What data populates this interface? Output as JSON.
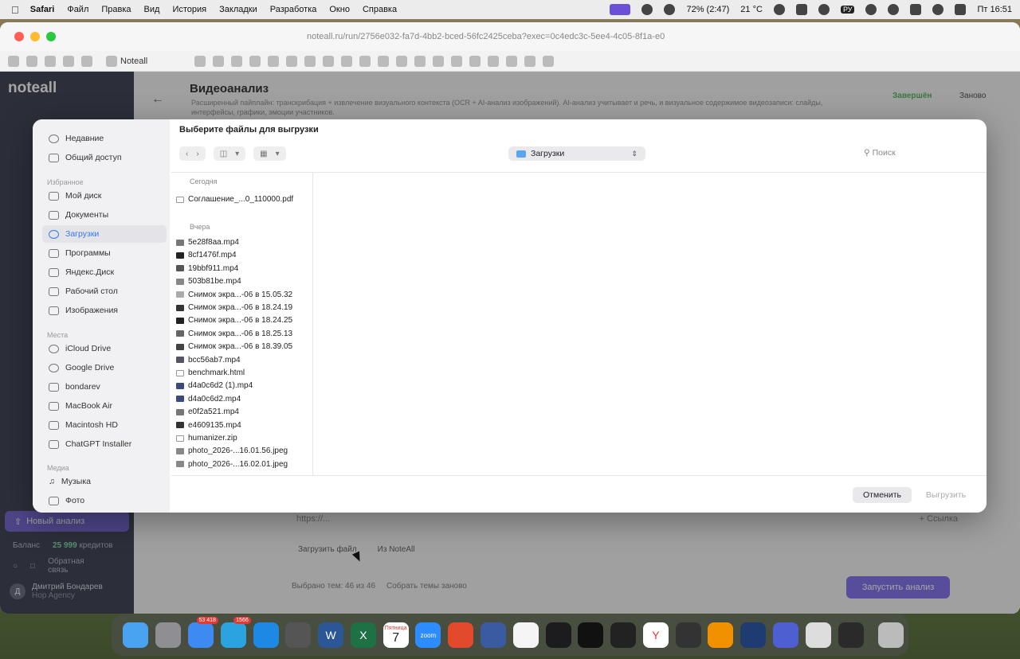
{
  "menubar": {
    "app": "Safari",
    "items": [
      "Файл",
      "Правка",
      "Вид",
      "История",
      "Закладки",
      "Разработка",
      "Окно",
      "Справка"
    ],
    "battery": "72% (2:47)",
    "weather": "21 °C",
    "lang": "РУ",
    "clock": "Пт 16:51"
  },
  "browser": {
    "url": "noteall.ru/run/2756e032-fa7d-4bb2-bced-56fc2425ceba?exec=0c4edc3c-5ee4-4c05-8f1a-e0",
    "bookmark_label": "Noteall"
  },
  "app": {
    "logo": "noteall",
    "page_title": "Видеоанализ",
    "page_description": "Расширенный пайплайн: транскрибация + извлечение визуального контекста (OCR + AI-анализ изображений). AI-анализ учитывает и речь, и визуальное содержимое видеозаписи: слайды, интерфейсы, графики, эмоции участников.",
    "status": "Завершён",
    "restart": "Заново",
    "new_analysis": "Новый анализ",
    "balance_label": "Баланс",
    "balance_value": "25 999",
    "balance_unit": "кредитов",
    "feedback": "Обратная связь",
    "user_name": "Дмитрий Бондарев",
    "user_sub": "Hop Agency",
    "user_initial": "Д",
    "url_placeholder": "https://...",
    "add_link": "+ Ссылка",
    "upload_file": "Загрузить файл",
    "from_noteall": "Из NoteAll",
    "selected_topics": "Выбрано тем: 46 из 46",
    "collect_topics": "Собрать темы заново",
    "run_analysis": "Запустить анализ"
  },
  "dialog": {
    "title": "Выберите файлы для выгрузки",
    "location": "Загрузки",
    "search": "Поиск",
    "cancel": "Отменить",
    "upload": "Выгрузить",
    "sidebar": {
      "recent": "Недавние",
      "shared": "Общий доступ",
      "fav_header": "Избранное",
      "my_disk": "Мой диск",
      "documents": "Документы",
      "downloads": "Загрузки",
      "programs": "Программы",
      "yandex": "Яндекс.Диск",
      "desktop": "Рабочий стол",
      "images": "Изображения",
      "places_header": "Места",
      "icloud": "iCloud Drive",
      "gdrive": "Google Drive",
      "bondarev": "bondarev",
      "macbook": "MacBook Air",
      "macintosh": "Macintosh HD",
      "chatgpt": "ChatGPT Installer",
      "media_header": "Медиа",
      "music": "Музыка",
      "photo": "Фото"
    },
    "today_label": "Сегодня",
    "today_files": [
      "Соглашение_...0_110000.pdf"
    ],
    "yesterday_label": "Вчера",
    "yesterday_files": [
      "5e28f8aa.mp4",
      "8cf1476f.mp4",
      "19bbf911.mp4",
      "503b81be.mp4",
      "Снимок экра...-06 в 15.05.32",
      "Снимок экра...-06 в 18.24.19",
      "Снимок экра...-06 в 18.24.25",
      "Снимок экра...-06 в 18.25.13",
      "Снимок экра...-06 в 18.39.05",
      "bcc56ab7.mp4",
      "benchmark.html",
      "d4a0c6d2 (1).mp4",
      "d4a0c6d2.mp4",
      "e0f2a521.mp4",
      "e4609135.mp4",
      "humanizer.zip",
      "photo_2026-...16.01.56.jpeg",
      "photo_2026-...16.02.01.jpeg"
    ]
  },
  "dock": {
    "mail_badge": "53 418",
    "telegram_badge": "1566",
    "calendar_day": "7",
    "calendar_month": "Пятница",
    "zoom": "zoom"
  }
}
